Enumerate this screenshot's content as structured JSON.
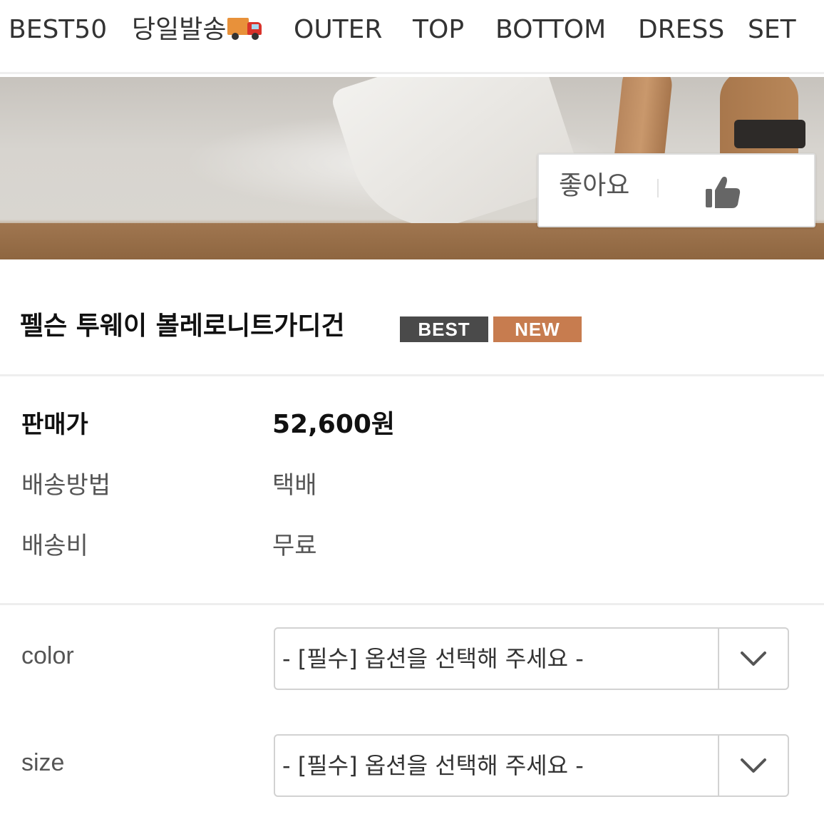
{
  "nav": {
    "items": [
      "BEST50",
      "당일발송",
      "OUTER",
      "TOP",
      "BOTTOM",
      "DRESS",
      "SET"
    ],
    "same_day_icon": "delivery-truck-icon"
  },
  "like": {
    "label": "좋아요",
    "icon": "thumbs-up-icon"
  },
  "product": {
    "title": "펠슨 투웨이 볼레로니트가디건",
    "badges": [
      "BEST",
      "NEW"
    ]
  },
  "info": [
    {
      "label": "판매가",
      "value": "52,600원"
    },
    {
      "label": "배송방법",
      "value": "택배"
    },
    {
      "label": "배송비",
      "value": "무료"
    }
  ],
  "options": [
    {
      "label": "color",
      "selected": "- [필수] 옵션을 선택해 주세요 -"
    },
    {
      "label": "size",
      "selected": "- [필수] 옵션을 선택해 주세요 -"
    }
  ],
  "colors": {
    "badge_best": "#4a4a4a",
    "badge_new": "#c77c4f"
  }
}
